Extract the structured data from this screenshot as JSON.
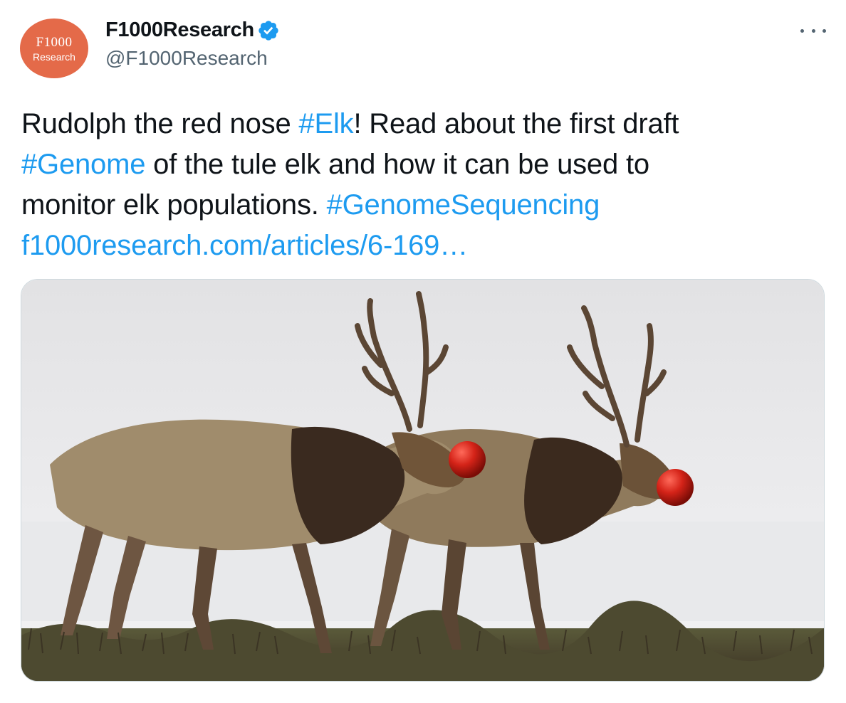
{
  "account": {
    "avatar_line1": "F1000",
    "avatar_line2": "Research",
    "display_name": "F1000Research",
    "handle": "@F1000Research",
    "verified": true
  },
  "tweet": {
    "lines": [
      [
        {
          "text": "Rudolph the red nose ",
          "kind": "text"
        },
        {
          "text": "#Elk",
          "kind": "hashtag"
        },
        {
          "text": "! Read about the first draft",
          "kind": "text"
        }
      ],
      [
        {
          "text": "#Genome",
          "kind": "hashtag"
        },
        {
          "text": " of the tule elk and how it can be used to",
          "kind": "text"
        }
      ],
      [
        {
          "text": "monitor elk populations. ",
          "kind": "text"
        },
        {
          "text": "#GenomeSequencing",
          "kind": "hashtag"
        }
      ],
      [
        {
          "text": "f1000research.com/articles/6-169…",
          "kind": "link"
        }
      ]
    ]
  },
  "media": {
    "subject": "two-tule-elk-with-red-noses",
    "icon": "photo"
  },
  "colors": {
    "link": "#1d9bf0",
    "verified_badge": "#1d9bf0",
    "avatar_bg": "#e46a49",
    "secondary_text": "#536471"
  },
  "icons": {
    "verified": "verified-badge-icon",
    "more": "more-dots-icon"
  }
}
